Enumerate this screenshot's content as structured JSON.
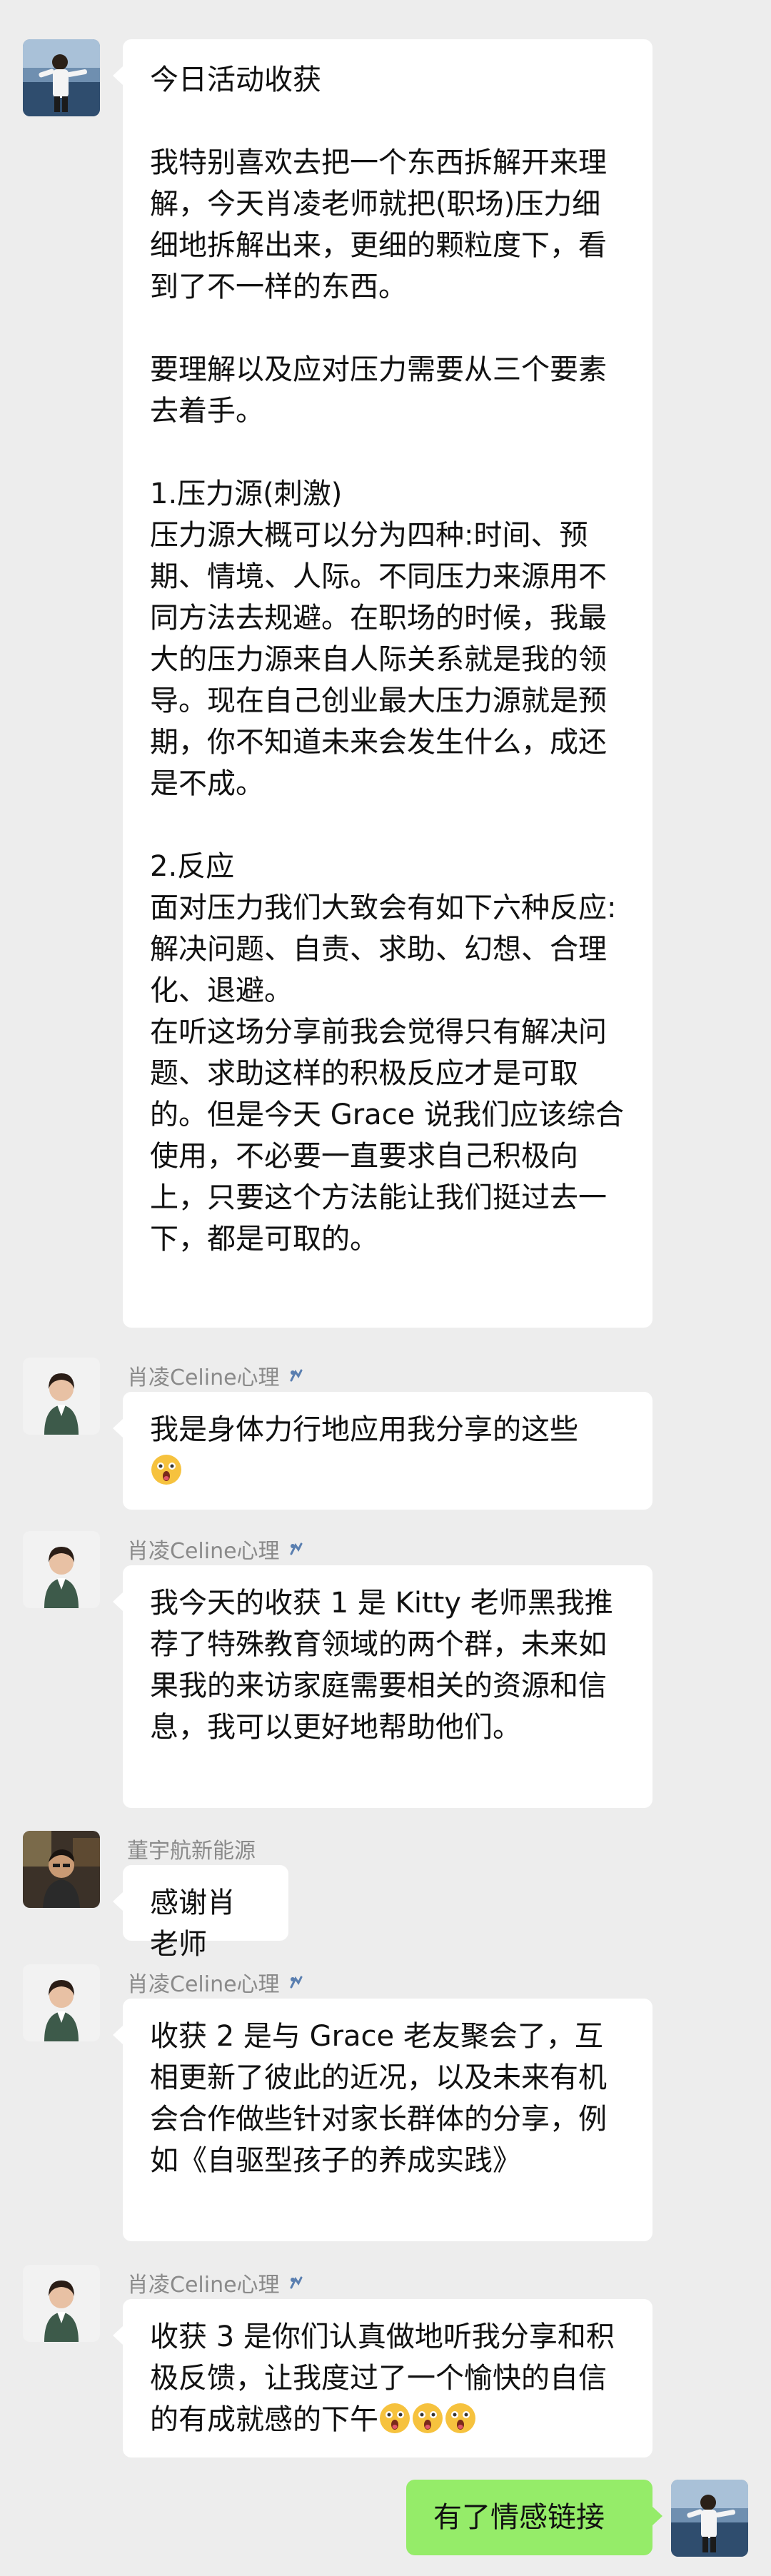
{
  "messages": [
    {
      "sender": "",
      "paragraphs": [
        "今日活动收获",
        "我特别喜欢去把一个东西拆解开来理解，今天肖凌老师就把(职场)压力细细地拆解出来，更细的颗粒度下，看到了不一样的东西。",
        "要理解以及应对压力需要从三个要素去着手。",
        "1.压力源(刺激)\n压力源大概可以分为四种:时间、预期、情境、人际。不同压力来源用不同方法去规避。在职场的时候，我最大的压力源来自人际关系就是我的领导。现在自己创业最大压力源就是预期，你不知道未来会发生什么，成还是不成。",
        "2.反应\n面对压力我们大致会有如下六种反应:解决问题、自责、求助、幻想、合理化、退避。\n在听这场分享前我会觉得只有解决问题、求助这样的积极反应才是可取的。但是今天 Grace 说我们应该综合使用，不必要一直要求自己积极向上，只要这个方法能让我们挺过去一下，都是可取的。"
      ]
    },
    {
      "sender": "肖凌Celine心理",
      "text": "我是身体力行地应用我分享的这些"
    },
    {
      "sender": "肖凌Celine心理",
      "text": "我今天的收获 1 是 Kitty 老师黑我推荐了特殊教育领域的两个群，未来如果我的来访家庭需要相关的资源和信息，我可以更好地帮助他们。"
    },
    {
      "sender": "董宇航新能源",
      "text": "感谢肖老师"
    },
    {
      "sender": "肖凌Celine心理",
      "text": "收获 2 是与 Grace 老友聚会了，互相更新了彼此的近况，以及未来有机会合作做些针对家长群体的分享，例如《自驱型孩子的养成实践》"
    },
    {
      "sender": "肖凌Celine心理",
      "text": "收获 3 是你们认真做地听我分享和积极反馈，让我度过了一个愉快的自信的有成就感的下午"
    },
    {
      "sender": "",
      "text": "有了情感链接"
    }
  ],
  "colors": {
    "background": "#ededed",
    "bubble_other": "#ffffff",
    "bubble_mine": "#95ec69",
    "sender_name": "#8a8a8a"
  },
  "icons": {
    "badge": "wechat-work-badge-icon",
    "emoji": "surprised-face-emoji"
  }
}
